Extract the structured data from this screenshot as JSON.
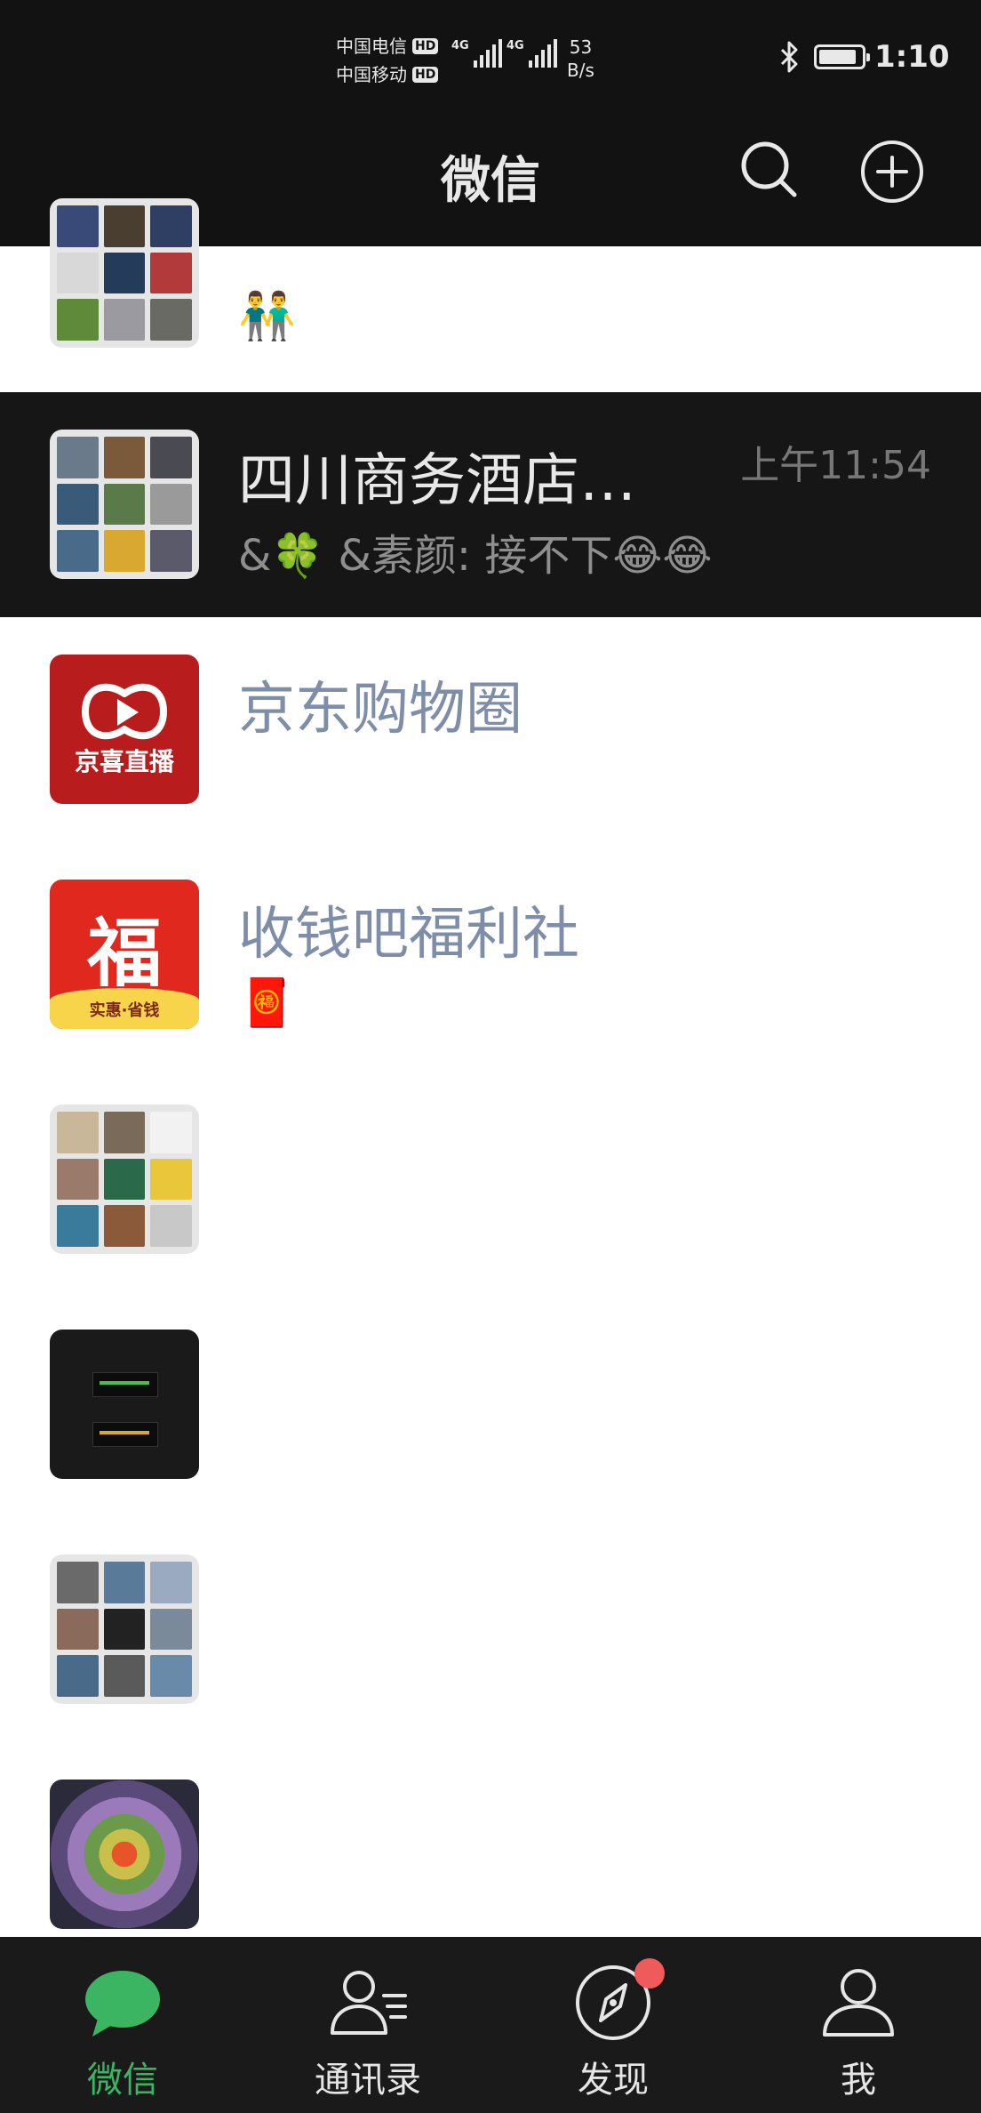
{
  "status_bar": {
    "carrier_1": "中国电信",
    "carrier_2": "中国移动",
    "hd_badge": "HD",
    "network_type": "4G",
    "speed_value": "53",
    "speed_unit": "B/s",
    "battery_level": 0.9,
    "time": "1:10"
  },
  "header": {
    "title": "微信",
    "search_icon": "search-icon",
    "add_icon": "plus-circle-icon"
  },
  "chats": [
    {
      "name": "",
      "preview": "👬",
      "time": "",
      "avatar": "group-grid"
    },
    {
      "name": "四川商务酒店…",
      "preview": "&🍀 &素颜: 接不下😂😂",
      "time": "上午11:54",
      "avatar": "group-grid",
      "highlighted": true
    },
    {
      "name": "京东购物圈",
      "preview": "",
      "time": "",
      "avatar_text": "京喜直播",
      "avatar_color": "#b81c1c"
    },
    {
      "name": "收钱吧福利社",
      "preview": "🧧",
      "time": "",
      "avatar_text": "福",
      "avatar_subtext": "实惠·省钱",
      "avatar_color": "#e0281e"
    },
    {
      "name": "",
      "preview": "",
      "time": "",
      "avatar": "group-grid"
    },
    {
      "name": "",
      "preview": "",
      "time": "",
      "avatar": "photo-dark-box"
    },
    {
      "name": "",
      "preview": "",
      "time": "",
      "avatar": "group-grid"
    },
    {
      "name": "",
      "preview": "",
      "time": "",
      "avatar": "photo-mandala"
    }
  ],
  "bottom_nav": {
    "items": [
      {
        "label": "微信",
        "icon": "chat-bubble-icon",
        "active": true
      },
      {
        "label": "通讯录",
        "icon": "contacts-icon",
        "active": false
      },
      {
        "label": "发现",
        "icon": "compass-icon",
        "active": false,
        "badge": true
      },
      {
        "label": "我",
        "icon": "person-icon",
        "active": false
      }
    ]
  },
  "colors": {
    "accent": "#3cb563",
    "header_bg": "#121212",
    "highlight_row_bg": "#161616",
    "name_text": "#7f8ea8",
    "badge": "#f05a5a"
  }
}
